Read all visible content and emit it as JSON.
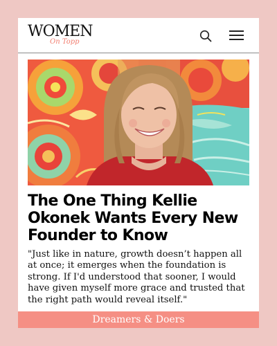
{
  "logo": {
    "main": "WOMEN",
    "sub": "On Topp"
  },
  "header": {
    "search_icon": "search-icon",
    "menu_icon": "hamburger-menu-icon"
  },
  "article": {
    "headline": "The One Thing Kellie Okonek Wants Every New Founder to Know",
    "quote": "\"Just like in nature, growth doesn’t happen all at once; it emerges when the foundation is strong. If I'd understood that sooner, I would have given myself more grace and trusted that the right path would reveal itself.\""
  },
  "footer": {
    "label": "Dreamers & Doers"
  },
  "colors": {
    "page_background": "#efc8c4",
    "card": "#ffffff",
    "accent": "#f58f84",
    "logo_sub": "#f27e70"
  }
}
